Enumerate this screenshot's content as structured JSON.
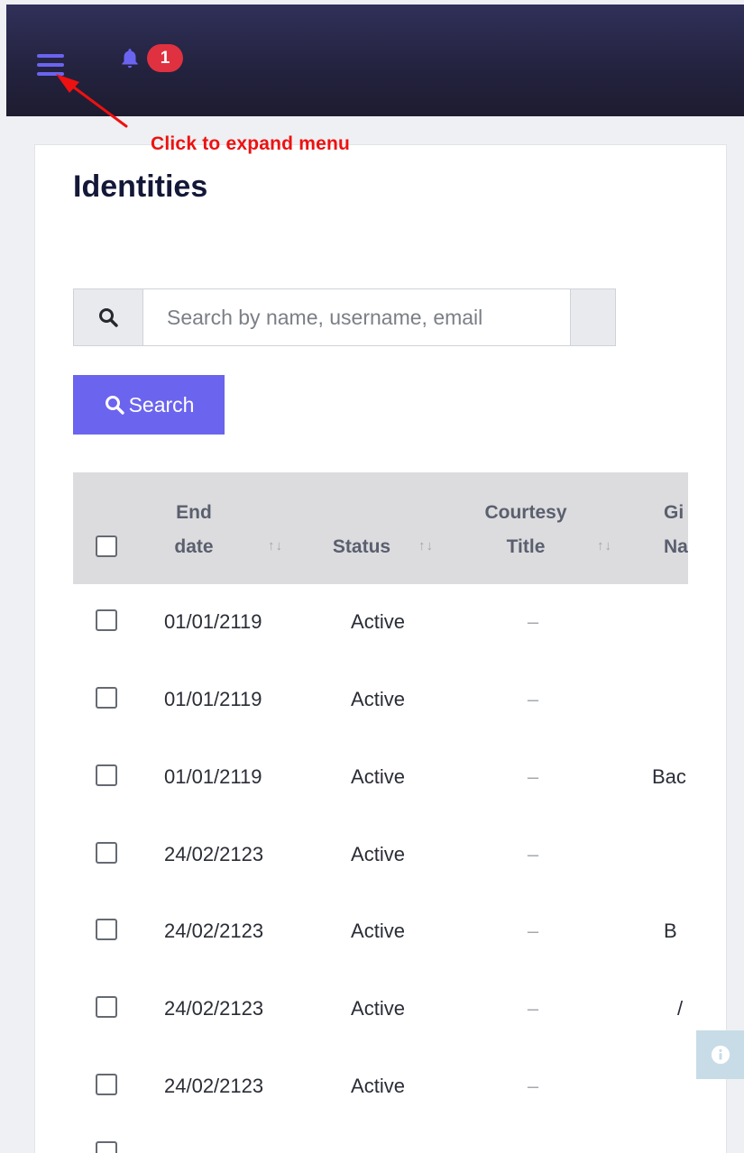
{
  "header": {
    "notification_count": "1"
  },
  "annotation": {
    "text": "Click to expand menu",
    "color": "#ee1111"
  },
  "page": {
    "title": "Identities"
  },
  "search": {
    "placeholder": "Search by name, username, email",
    "button_label": "Search"
  },
  "table": {
    "columns": [
      {
        "line1": "End",
        "line2": "date"
      },
      {
        "line1": "",
        "line2": "Status"
      },
      {
        "line1": "Courtesy",
        "line2": "Title"
      },
      {
        "line1": "Gi",
        "line2": "Na"
      }
    ],
    "rows": [
      {
        "end_date": "01/01/2119",
        "status": "Active",
        "title": "–",
        "given": ""
      },
      {
        "end_date": "01/01/2119",
        "status": "Active",
        "title": "–",
        "given": ""
      },
      {
        "end_date": "01/01/2119",
        "status": "Active",
        "title": "–",
        "given": "Bac"
      },
      {
        "end_date": "24/02/2123",
        "status": "Active",
        "title": "–",
        "given": ""
      },
      {
        "end_date": "24/02/2123",
        "status": "Active",
        "title": "–",
        "given": "B"
      },
      {
        "end_date": "24/02/2123",
        "status": "Active",
        "title": "–",
        "given": "/"
      },
      {
        "end_date": "24/02/2123",
        "status": "Active",
        "title": "–",
        "given": ""
      }
    ]
  },
  "colors": {
    "accent": "#6b64ef",
    "badge": "#e03140",
    "header_bg": "#242340",
    "title": "#141838"
  },
  "icons": {
    "menu": "hamburger-menu-icon",
    "notification": "bell-icon",
    "search": "search-icon",
    "info": "info-icon"
  }
}
